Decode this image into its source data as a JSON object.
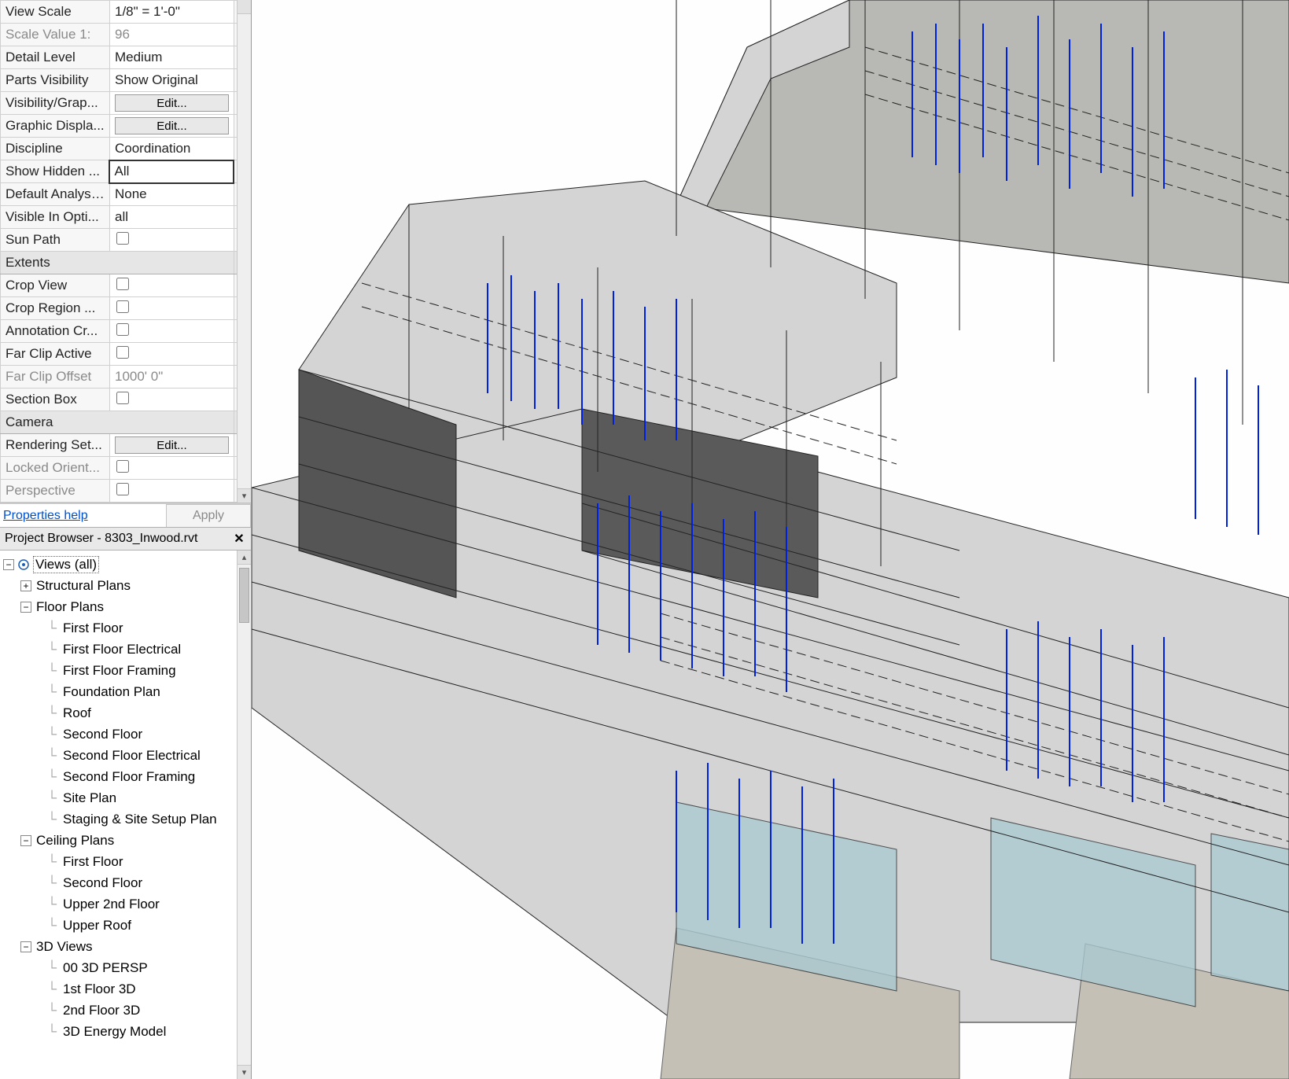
{
  "properties": {
    "rows": [
      {
        "name": "View Scale",
        "value": "1/8\" = 1'-0\"",
        "type": "text"
      },
      {
        "name": "Scale Value    1:",
        "value": "96",
        "type": "text",
        "dim": true
      },
      {
        "name": "Detail Level",
        "value": "Medium",
        "type": "text"
      },
      {
        "name": "Parts Visibility",
        "value": "Show Original",
        "type": "text"
      },
      {
        "name": "Visibility/Grap...",
        "value": "Edit...",
        "type": "button"
      },
      {
        "name": "Graphic Displa...",
        "value": "Edit...",
        "type": "button"
      },
      {
        "name": "Discipline",
        "value": "Coordination",
        "type": "text"
      },
      {
        "name": "Show Hidden ...",
        "value": "All",
        "type": "text",
        "active": true
      },
      {
        "name": "Default Analysi...",
        "value": "None",
        "type": "text"
      },
      {
        "name": "Visible In Opti...",
        "value": "all",
        "type": "text"
      },
      {
        "name": "Sun Path",
        "value": false,
        "type": "check"
      }
    ],
    "extents_label": "Extents",
    "extents": [
      {
        "name": "Crop View",
        "value": false,
        "type": "check"
      },
      {
        "name": "Crop Region ...",
        "value": false,
        "type": "check"
      },
      {
        "name": "Annotation Cr...",
        "value": false,
        "type": "check"
      },
      {
        "name": "Far Clip Active",
        "value": false,
        "type": "check"
      },
      {
        "name": "Far Clip Offset",
        "value": "1000'  0\"",
        "type": "text",
        "dim": true
      },
      {
        "name": "Section Box",
        "value": false,
        "type": "check"
      }
    ],
    "camera_label": "Camera",
    "camera": [
      {
        "name": "Rendering Set...",
        "value": "Edit...",
        "type": "button"
      },
      {
        "name": "Locked Orient...",
        "value": false,
        "type": "check",
        "dim": true
      },
      {
        "name": "Perspective",
        "value": false,
        "type": "check",
        "dim": true
      }
    ],
    "help_label": "Properties help",
    "apply_label": "Apply"
  },
  "browser": {
    "title": "Project Browser - 8303_Inwood.rvt",
    "root": "Views (all)",
    "groups": [
      {
        "label": "Structural Plans",
        "collapsed": true
      },
      {
        "label": "Floor Plans",
        "collapsed": false,
        "items": [
          "First Floor",
          "First Floor Electrical",
          "First Floor Framing",
          "Foundation Plan",
          "Roof",
          "Second Floor",
          "Second Floor Electrical",
          "Second Floor Framing",
          "Site Plan",
          "Staging & Site Setup Plan"
        ]
      },
      {
        "label": "Ceiling Plans",
        "collapsed": false,
        "items": [
          "First Floor",
          "Second Floor",
          "Upper 2nd Floor",
          "Upper Roof"
        ]
      },
      {
        "label": "3D Views",
        "collapsed": false,
        "items": [
          "00 3D PERSP",
          "1st Floor 3D",
          "2nd Floor 3D",
          "3D Energy Model"
        ]
      }
    ]
  }
}
